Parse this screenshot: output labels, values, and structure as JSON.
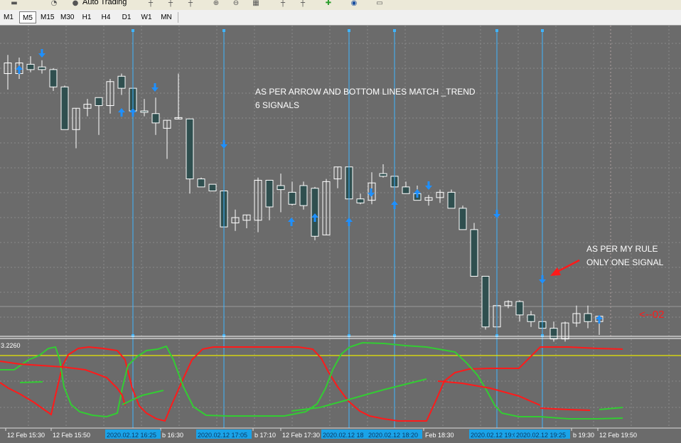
{
  "toolbar": {
    "autotrading_label": "Auto Trading",
    "timeframes": [
      "M1",
      "M5",
      "M15",
      "M30",
      "H1",
      "H4",
      "D1",
      "W1",
      "MN"
    ],
    "active_timeframe": "M5"
  },
  "main_chart": {
    "annotation_1": [
      "AS PER ARROW AND BOTTOM LINES MATCH _TREND",
      "6 SIGNALS"
    ],
    "annotation_2": [
      "AS PER MY RULE",
      "ONLY ONE SIGNAL"
    ],
    "right_marker": "<--02"
  },
  "indicator": {
    "level_label": "3.2260"
  },
  "time_axis": {
    "labels": [
      "12 Feb 15:30",
      "12 Feb 15:50",
      "b 16:30",
      "b 17:10",
      "12 Feb 17:30",
      "Feb 18:30",
      "b 19:30",
      "12 Feb 19:50"
    ],
    "highlighted": [
      "2020.02.12 16:25",
      "2020.02.12 17:05",
      "2020.02.12 18",
      "2020.02.12 18:20",
      "2020.02.12 19:05",
      "2020.02.12 19:25"
    ]
  },
  "colors": {
    "background": "#6b6b6b",
    "bull_candle": "#ffffff",
    "bear_candle": "#2f4f4f",
    "vertical_line": "#3fb4ff",
    "arrow": "#1e90ff",
    "red_line": "#ff1a1a",
    "green_line": "#33cc33",
    "level_line": "#e8e800",
    "time_highlight": "#1aa3e8"
  },
  "candles": [
    {
      "o": 1.0,
      "h": 0.3,
      "l": 1.6,
      "c": 0.6
    },
    {
      "o": 1.0,
      "h": 0.4,
      "l": 1.2,
      "c": 0.6
    },
    {
      "o": 0.65,
      "h": 0.35,
      "l": 0.95,
      "c": 0.85
    },
    {
      "o": 0.75,
      "h": 0.5,
      "l": 1.0,
      "c": 0.85
    },
    {
      "o": 0.85,
      "h": 0.8,
      "l": 1.65,
      "c": 1.5
    },
    {
      "o": 1.5,
      "h": 1.45,
      "l": 3.1,
      "c": 3.1
    },
    {
      "o": 3.1,
      "h": 2.3,
      "l": 3.8,
      "c": 2.3
    },
    {
      "o": 2.3,
      "h": 1.95,
      "l": 2.6,
      "c": 2.15
    },
    {
      "o": 1.9,
      "h": 1.9,
      "l": 3.3,
      "c": 2.2
    },
    {
      "o": 2.2,
      "h": 1.2,
      "l": 2.5,
      "c": 1.3
    },
    {
      "o": 1.1,
      "h": 1.0,
      "l": 1.8,
      "c": 1.55
    },
    {
      "o": 1.55,
      "h": 1.55,
      "l": 2.8,
      "c": 2.4
    },
    {
      "o": 2.4,
      "h": 1.95,
      "l": 2.6,
      "c": 2.45
    },
    {
      "o": 2.5,
      "h": 1.9,
      "l": 3.3,
      "c": 2.85
    },
    {
      "o": 3.05,
      "h": 2.9,
      "l": 4.2,
      "c": 2.75
    },
    {
      "o": 2.7,
      "h": 1.0,
      "l": 1.1,
      "c": 2.65
    },
    {
      "o": 2.7,
      "h": 2.7,
      "l": 5.5,
      "c": 4.95
    },
    {
      "o": 4.95,
      "h": 4.9,
      "l": 5.15,
      "c": 5.25
    },
    {
      "o": 5.15,
      "h": 5.25,
      "l": 5.3,
      "c": 5.4
    },
    {
      "o": 5.4,
      "h": 5.4,
      "l": 6.9,
      "c": 6.75
    },
    {
      "o": 6.6,
      "h": 6.1,
      "l": 6.9,
      "c": 6.4
    },
    {
      "o": 6.5,
      "h": 6.3,
      "l": 6.8,
      "c": 6.3
    },
    {
      "o": 6.5,
      "h": 4.9,
      "l": 6.95,
      "c": 5.0
    },
    {
      "o": 5.0,
      "h": 5.0,
      "l": 6.5,
      "c": 6.0
    },
    {
      "o": 5.2,
      "h": 4.75,
      "l": 6.2,
      "c": 5.35
    },
    {
      "o": 5.45,
      "h": 5.05,
      "l": 5.95,
      "c": 5.9
    },
    {
      "o": 5.2,
      "h": 5.05,
      "l": 6.1,
      "c": 5.95
    },
    {
      "o": 5.3,
      "h": 5.25,
      "l": 7.25,
      "c": 7.1
    },
    {
      "o": 7.05,
      "h": 4.95,
      "l": 7.0,
      "c": 5.05
    },
    {
      "o": 4.95,
      "h": 4.5,
      "l": 5.3,
      "c": 4.5
    },
    {
      "o": 4.5,
      "h": 4.25,
      "l": 5.9,
      "c": 5.7
    },
    {
      "o": 5.7,
      "h": 5.5,
      "l": 5.9,
      "c": 5.85
    },
    {
      "o": 5.75,
      "h": 4.7,
      "l": 5.9,
      "c": 5.1
    },
    {
      "o": 4.75,
      "h": 4.4,
      "l": 4.9,
      "c": 4.85
    },
    {
      "o": 4.85,
      "h": 4.15,
      "l": 5.8,
      "c": 5.25
    },
    {
      "o": 5.25,
      "h": 5.05,
      "l": 5.3,
      "c": 5.5
    },
    {
      "o": 5.5,
      "h": 5.2,
      "l": 5.75,
      "c": 5.75
    },
    {
      "o": 5.75,
      "h": 5.55,
      "l": 5.95,
      "c": 5.65
    },
    {
      "o": 5.65,
      "h": 5.35,
      "l": 5.85,
      "c": 5.45
    },
    {
      "o": 5.45,
      "h": 5.35,
      "l": 6.05,
      "c": 6.05
    },
    {
      "o": 6.05,
      "h": 5.95,
      "l": 6.85,
      "c": 6.85
    },
    {
      "o": 6.85,
      "h": 6.6,
      "l": 8.6,
      "c": 8.6
    },
    {
      "o": 8.6,
      "h": 8.6,
      "l": 10.6,
      "c": 10.5
    },
    {
      "o": 10.5,
      "h": 9.7,
      "l": 10.9,
      "c": 9.7
    },
    {
      "o": 9.7,
      "h": 9.5,
      "l": 9.8,
      "c": 9.55
    },
    {
      "o": 9.55,
      "h": 9.5,
      "l": 10.3,
      "c": 10.05
    },
    {
      "o": 10.05,
      "h": 9.9,
      "l": 10.5,
      "c": 10.3
    },
    {
      "o": 10.3,
      "h": 10.1,
      "l": 10.6,
      "c": 10.55
    },
    {
      "o": 10.55,
      "h": 10.3,
      "l": 11.05,
      "c": 10.95
    },
    {
      "o": 10.95,
      "h": 10.3,
      "l": 11.05,
      "c": 10.35
    },
    {
      "o": 10.35,
      "h": 9.7,
      "l": 10.5,
      "c": 10.0
    },
    {
      "o": 10.0,
      "h": 9.7,
      "l": 10.55,
      "c": 10.3
    },
    {
      "o": 10.3,
      "h": 10.2,
      "l": 10.8,
      "c": 10.1
    }
  ]
}
